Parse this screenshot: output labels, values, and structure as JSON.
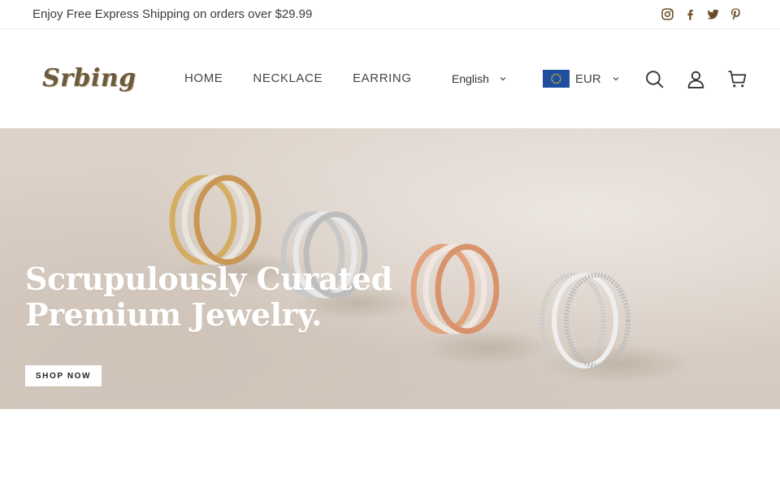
{
  "announcement": {
    "text": "Enjoy Free Express Shipping on orders over $29.99",
    "social": [
      "instagram-icon",
      "facebook-icon",
      "twitter-icon",
      "pinterest-icon"
    ]
  },
  "header": {
    "logo": "Srbing",
    "nav": [
      {
        "label": "HOME"
      },
      {
        "label": "NECKLACE"
      },
      {
        "label": "EARRING"
      }
    ],
    "language": "English",
    "currency": "EUR",
    "icons": [
      "search-icon",
      "account-icon",
      "cart-icon"
    ]
  },
  "hero": {
    "headline_line1": "Scrupulously Curated",
    "headline_line2": "Premium Jewelry.",
    "button": "SHOP NOW"
  },
  "colors": {
    "brand": "#6b5a3e",
    "hero_bg": "#d9cfc6",
    "social_icon": "#6b4a2a"
  }
}
